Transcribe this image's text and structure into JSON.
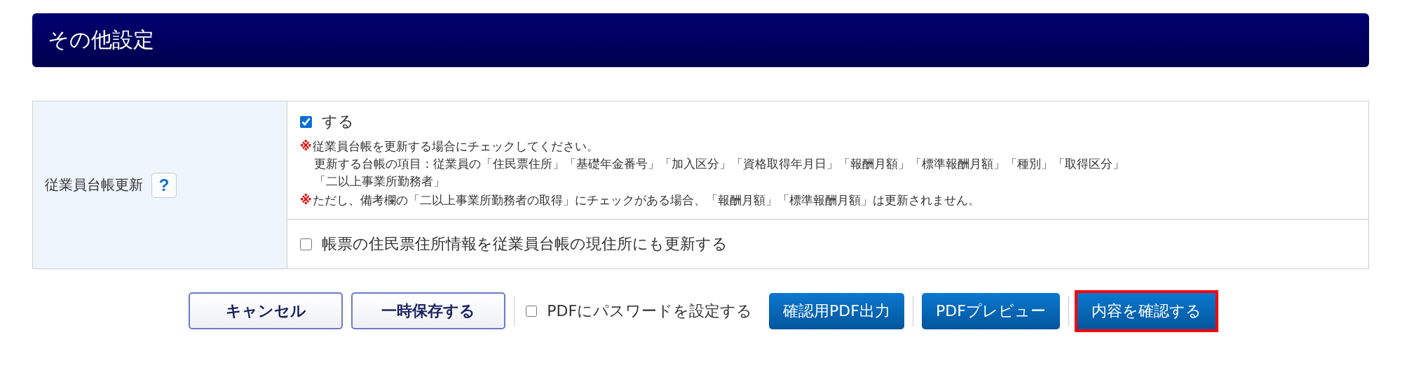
{
  "header": {
    "title": "その他設定"
  },
  "settings": [
    {
      "label": "従業員台帳更新",
      "help": "?",
      "options": [
        {
          "label": "する",
          "checked": true,
          "notes": [
            {
              "mark": "※",
              "lines": [
                "従業員台帳を更新する場合にチェックしてください。",
                "更新する台帳の項目：従業員の「住民票住所」「基礎年金番号」「加入区分」「資格取得年月日」「報酬月額」「標準報酬月額」「種別」「取得区分」",
                "「二以上事業所勤務者」"
              ]
            },
            {
              "mark": "※",
              "lines": [
                "ただし、備考欄の「二以上事業所勤務者の取得」にチェックがある場合、「報酬月額」「標準報酬月額」は更新されません。"
              ]
            }
          ]
        },
        {
          "label": "帳票の住民票住所情報を従業員台帳の現住所にも更新する",
          "checked": false
        }
      ]
    }
  ],
  "actions": [
    {
      "kind": "outline",
      "label": "キャンセル"
    },
    {
      "kind": "outline",
      "label": "一時保存する"
    },
    {
      "kind": "separator"
    },
    {
      "kind": "checkbox",
      "label": "PDFにパスワードを設定する",
      "checked": false
    },
    {
      "kind": "primary",
      "label": "確認用PDF出力",
      "highlighted": false
    },
    {
      "kind": "separator"
    },
    {
      "kind": "primary",
      "label": "PDFプレビュー",
      "highlighted": false
    },
    {
      "kind": "separator"
    },
    {
      "kind": "primary",
      "label": "内容を確認する",
      "highlighted": true
    }
  ]
}
